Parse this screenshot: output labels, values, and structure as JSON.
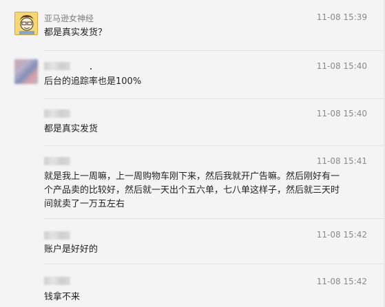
{
  "messages": [
    {
      "sender": "亚马逊女神经",
      "time": "11-08 15:39",
      "text": "都是真实发货？"
    },
    {
      "sender": "",
      "time": "11-08 15:40",
      "text": "后台的追踪率也是100%"
    },
    {
      "sender": "",
      "time": "11-08 15:40",
      "text": "都是真实发货"
    },
    {
      "sender": "",
      "time": "11-08 15:41",
      "text_lines": [
        "就是我上一周嘛，上一周购物车刚下来，然后我就开广告嘛。然后刚好有一",
        "个产品卖的比较好，然后就一天出个五六单，七八单这样子，然后就三天时",
        "间就卖了一万五左右"
      ]
    },
    {
      "sender": "",
      "time": "11-08 15:42",
      "text": "账户是好好的"
    },
    {
      "sender": "",
      "time": "11-08 15:42",
      "text": "钱拿不来"
    }
  ],
  "colors": {
    "background": "#f4f4f4",
    "name": "#7b7b7b",
    "time": "#8a8a8a",
    "text": "#222222"
  },
  "icons": {
    "avatar_1": "cartoon-avatar",
    "avatar_2": "blurred-avatar"
  }
}
